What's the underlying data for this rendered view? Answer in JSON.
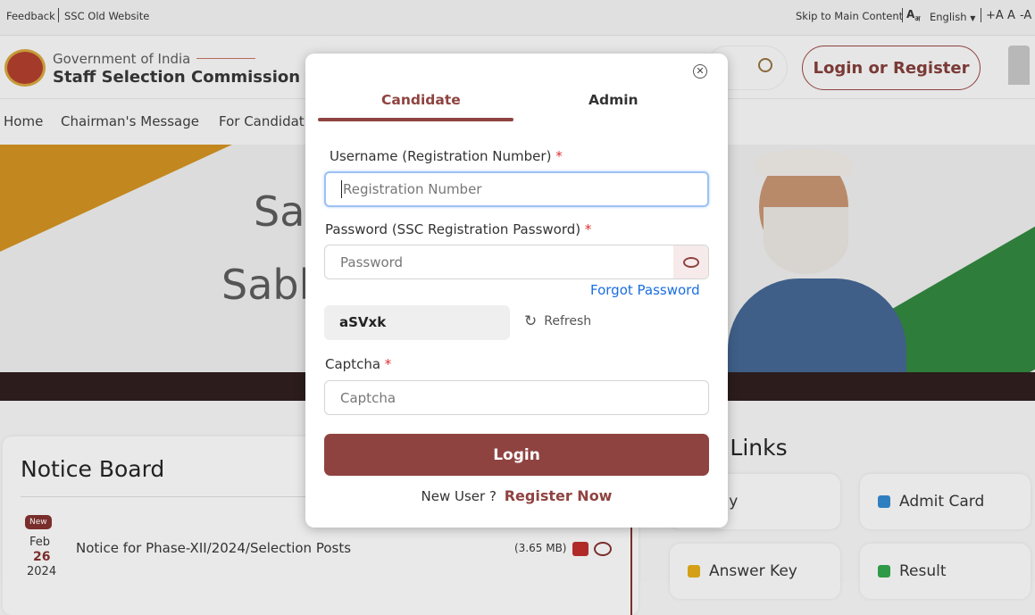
{
  "topbar": {
    "feedback": "Feedback",
    "old_website": "SSC Old Website",
    "skip": "Skip to Main Content",
    "language": "English",
    "font_increase": "+A",
    "font_normal": "A",
    "font_decrease": "-A"
  },
  "header": {
    "gov": "Government of India",
    "org": "Staff Selection Commission",
    "login_register": "Login or Register"
  },
  "nav": {
    "items": [
      "Home",
      "Chairman's Message",
      "For Candidat"
    ]
  },
  "hero": {
    "line1": "Sa",
    "line2": "Sabl"
  },
  "notice_board": {
    "title": "Notice Board",
    "items": [
      {
        "badge": "New",
        "month": "Feb",
        "day": "26",
        "year": "2024",
        "title": "Notice for Phase-XII/2024/Selection Posts",
        "size": "(3.65 MB)"
      }
    ]
  },
  "quick_links": {
    "title": "k Links",
    "items": [
      {
        "label": "pply"
      },
      {
        "label": "Admit Card",
        "color": "#2f7fc0"
      },
      {
        "label": "Answer Key",
        "color": "#d4a017"
      },
      {
        "label": "Result",
        "color": "#2e9a48"
      }
    ]
  },
  "modal": {
    "tabs": [
      {
        "label": "Candidate",
        "active": true
      },
      {
        "label": "Admin",
        "active": false
      }
    ],
    "username_label": "Username (Registration Number)",
    "username_placeholder": "Registration Number",
    "password_label": "Password (SSC Registration Password)",
    "password_placeholder": "Password",
    "required_mark": "*",
    "forgot": "Forgot Password",
    "captcha_code": "aSVxk",
    "refresh": "Refresh",
    "captcha_label": "Captcha",
    "captcha_placeholder": "Captcha",
    "login": "Login",
    "new_user": "New User ?",
    "register": "Register Now",
    "accent": "#8f4340",
    "link_color": "#1a6ee0"
  }
}
